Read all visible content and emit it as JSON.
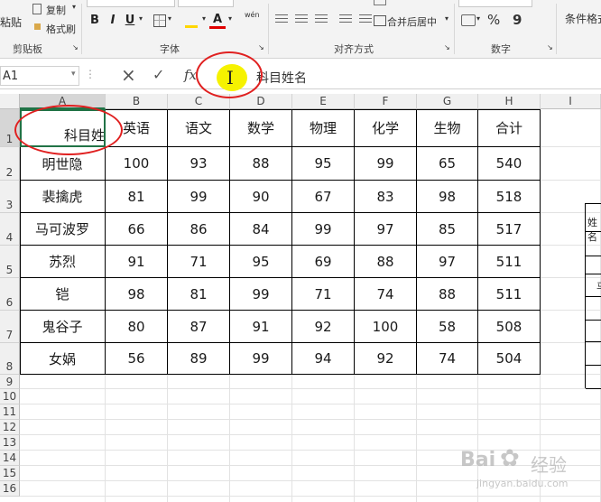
{
  "ribbon": {
    "paste_label": "粘贴",
    "copy_label": "复制",
    "format_painter_label": "格式刷",
    "clipboard_label": "剪贴板",
    "bold": "B",
    "italic": "I",
    "underline": "U",
    "font_color": "A",
    "font_group_label": "字体",
    "wen_label": "wén",
    "merge_center_label": "合并后居中",
    "alignment_group_label": "对齐方式",
    "percent_label": "%",
    "comma_label": "9",
    "number_group_label": "数字",
    "conditional_format_label": "条件格式"
  },
  "formula_bar": {
    "name_box": "A1",
    "cancel_icon": "×",
    "enter_icon": "✓",
    "fx_label": "fx",
    "cursor_icon": "I",
    "content": "科目姓名"
  },
  "columns": [
    "A",
    "B",
    "C",
    "D",
    "E",
    "F",
    "G",
    "H",
    "I"
  ],
  "rows": [
    "1",
    "2",
    "3",
    "4",
    "5",
    "6",
    "7",
    "8",
    "9",
    "10",
    "11",
    "12",
    "13",
    "14",
    "15",
    "16"
  ],
  "table": {
    "a1_text": "科目姓",
    "headers": [
      "英语",
      "语文",
      "数学",
      "物理",
      "化学",
      "生物",
      "合计"
    ],
    "data": [
      {
        "name": "明世隐",
        "values": [
          "100",
          "93",
          "88",
          "95",
          "99",
          "65",
          "540"
        ]
      },
      {
        "name": "裴擒虎",
        "values": [
          "81",
          "99",
          "90",
          "67",
          "83",
          "98",
          "518"
        ]
      },
      {
        "name": "马可波罗",
        "values": [
          "66",
          "86",
          "84",
          "99",
          "97",
          "85",
          "517"
        ]
      },
      {
        "name": "苏烈",
        "values": [
          "91",
          "71",
          "95",
          "69",
          "88",
          "97",
          "511"
        ]
      },
      {
        "name": "铠",
        "values": [
          "98",
          "81",
          "99",
          "71",
          "74",
          "88",
          "511"
        ]
      },
      {
        "name": "鬼谷子",
        "values": [
          "80",
          "87",
          "91",
          "92",
          "100",
          "58",
          "508"
        ]
      },
      {
        "name": "女娲",
        "values": [
          "56",
          "89",
          "99",
          "94",
          "92",
          "74",
          "504"
        ]
      }
    ]
  },
  "side_table": {
    "header_text": "姓名",
    "row_text": "马"
  },
  "watermark": {
    "brand": "Bai",
    "suffix": "经验",
    "url": "jingyan.baidu.com"
  },
  "colors": {
    "highlight_yellow": "#f6f200",
    "annotation_red": "#e02020",
    "font_color_bar": "#e00000"
  }
}
